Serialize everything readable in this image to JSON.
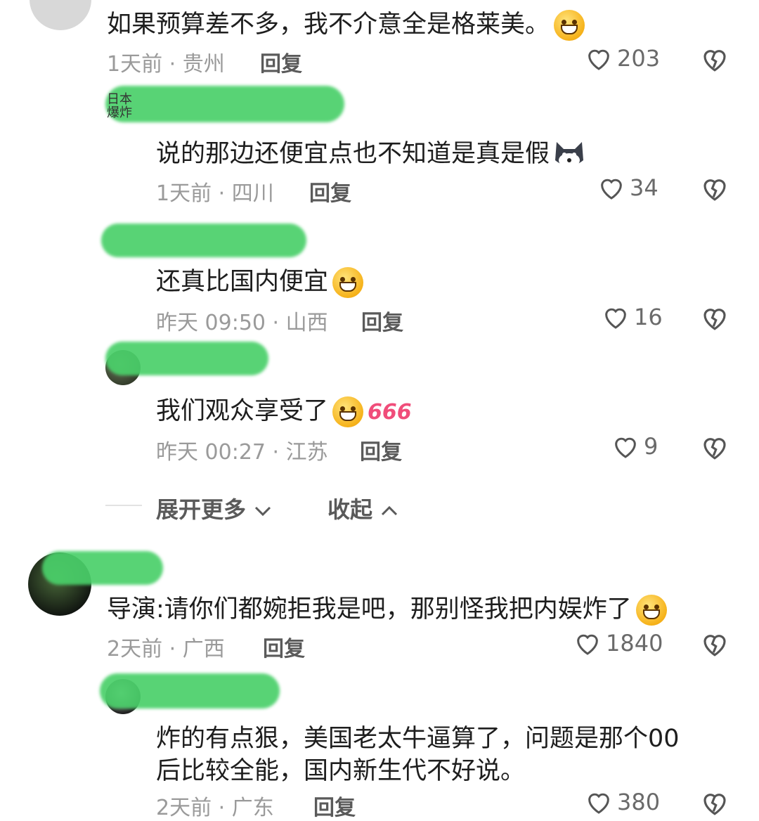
{
  "comments": [
    {
      "text": "如果预算差不多，我不介意全是格莱美。",
      "time": "1天前 · 贵州",
      "reply": "回复",
      "likes": "203",
      "emoji": "laugh-cry"
    },
    {
      "text": "说的那边还便宜点也不知道是真是假",
      "time": "1天前 · 四川",
      "reply": "回复",
      "likes": "34",
      "emoji": "dog"
    },
    {
      "text": "还真比国内便宜",
      "time": "昨天 09:50 · 山西",
      "reply": "回复",
      "likes": "16",
      "emoji": "sweat-grin"
    },
    {
      "text": "我们观众享受了",
      "time": "昨天 00:27 · 江苏",
      "reply": "回复",
      "likes": "9",
      "emoji": "grin",
      "badge": "666"
    },
    {
      "text": "导演:请你们都婉拒我是吧，那别怪我把内娱炸了",
      "time": "2天前 · 广西",
      "reply": "回复",
      "likes": "1840",
      "emoji": "dizzy"
    },
    {
      "text_line1": "炸的有点狠，美国老太牛逼算了，问题是那个00",
      "text_line2": "后比较全能，国内新生代不好说。",
      "time": "2天前 · 广东",
      "reply": "回复",
      "likes": "380"
    }
  ],
  "user_badge": {
    "line1": "日本",
    "line2": "爆炸"
  },
  "fold_bar": {
    "expand": "展开更多",
    "collapse": "收起"
  },
  "colors": {
    "censor_green": "#4ad06a",
    "meta_gray": "#9a9a9a",
    "emoji_yellow": "#f6b21a"
  }
}
